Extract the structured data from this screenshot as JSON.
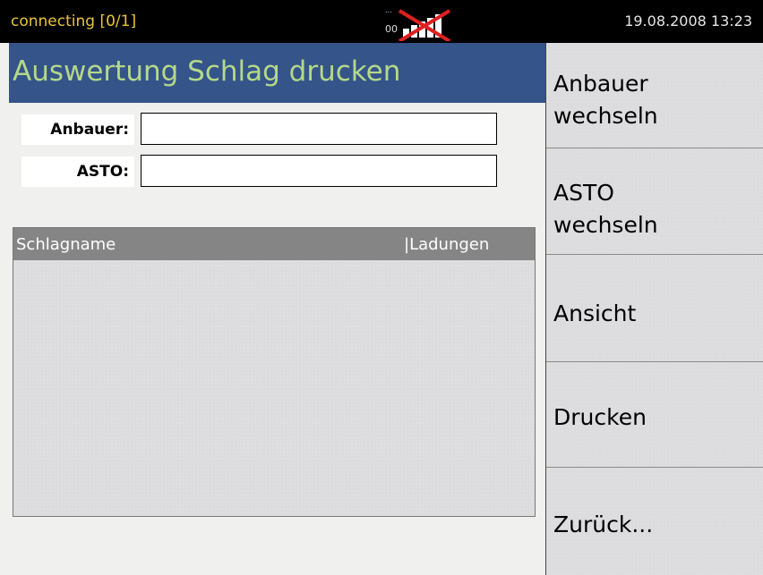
{
  "status_bar": {
    "connection": "connecting [0/1]",
    "signal_label": "00",
    "datetime": "19.08.2008  13:23",
    "signal_icon": "signal-strength-crossed-icon"
  },
  "panel": {
    "title": "Auswertung Schlag drucken",
    "fields": [
      {
        "label": "Anbauer:",
        "value": ""
      },
      {
        "label": "ASTO:",
        "value": ""
      }
    ],
    "table": {
      "columns": [
        "Schlagname",
        "|Ladungen"
      ],
      "rows": []
    }
  },
  "side_menu": {
    "buttons": [
      {
        "label": "Anbauer\nwechseln"
      },
      {
        "label": "ASTO\nwechseln"
      },
      {
        "label": "Ansicht"
      },
      {
        "label": "Drucken"
      },
      {
        "label": "Zurück..."
      }
    ]
  },
  "colors": {
    "title_bg": "#34548a",
    "title_text": "#b5d88a",
    "status_text": "#e8c43a",
    "header_bg": "#858585"
  }
}
